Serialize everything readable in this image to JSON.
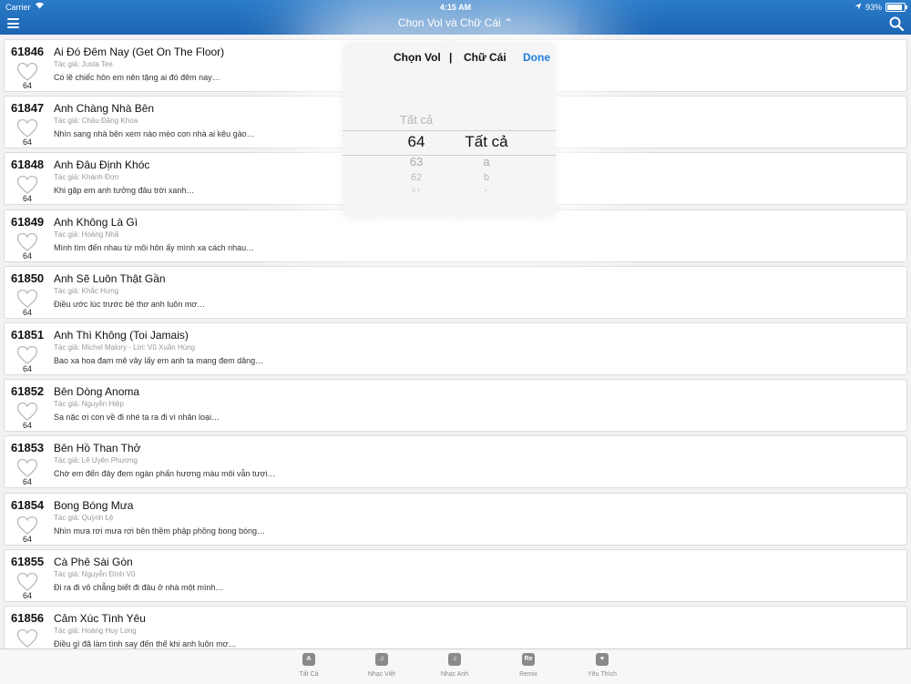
{
  "status": {
    "carrier": "Carrier",
    "time": "4:15 AM",
    "battery": "93%"
  },
  "nav": {
    "title": "Chọn Vol và Chữ Cái ⌃"
  },
  "songs": [
    {
      "id": "61846",
      "title": "Ai Đó Đêm Nay (Get On The Floor)",
      "author": "Tác giả: Justa Tee",
      "lyric": "Có lẽ chiếc hôn em nên tặng ai đó đêm nay…",
      "vol": "64"
    },
    {
      "id": "61847",
      "title": "Anh Chàng Nhà Bên",
      "author": "Tác giả: Châu Đăng Khoa",
      "lyric": "Nhìn sang nhà bên xem nào mèo con nhà ai kêu gào…",
      "vol": "64"
    },
    {
      "id": "61848",
      "title": "Anh Đâu Định Khóc",
      "author": "Tác giả: Khánh Đơn",
      "lyric": "Khi gặp em anh tưởng đâu trời xanh…",
      "vol": "64"
    },
    {
      "id": "61849",
      "title": "Anh Không Là Gì",
      "author": "Tác giả: Hoàng Nhã",
      "lyric": "Mình tìm đến nhau từ môi hôn ấy mình xa cách nhau…",
      "vol": "64"
    },
    {
      "id": "61850",
      "title": "Anh Sẽ Luôn Thật Gần",
      "author": "Tác giả: Khắc Hưng",
      "lyric": "Điều ước lúc trước bé thơ anh luôn mơ…",
      "vol": "64"
    },
    {
      "id": "61851",
      "title": "Anh Thì Không (Toi Jamais)",
      "author": "Tác giả: Michel Malory - Lời: Vũ Xuân Hùng",
      "lyric": "Bao xa hoa đam mê vây lấy em anh ta mang đem dâng…",
      "vol": "64"
    },
    {
      "id": "61852",
      "title": "Bên Dòng Anoma",
      "author": "Tác giả: Nguyễn Hiệp",
      "lyric": "Sa nặc ơi con về đi nhé ta ra đi vì nhân loại…",
      "vol": "64"
    },
    {
      "id": "61853",
      "title": "Bên Hồ Than Thở",
      "author": "Tác giả: Lê Uyên Phương",
      "lyric": "Chờ em đến đây đem ngàn phấn hương màu môi vẫn tươi…",
      "vol": "64"
    },
    {
      "id": "61854",
      "title": "Bong Bóng Mưa",
      "author": "Tác giả: Quỳnh Lệ",
      "lyric": "Nhìn mưa rơi mưa rơi bên thềm phập phồng bong bóng…",
      "vol": "64"
    },
    {
      "id": "61855",
      "title": "Cà Phê Sài Gòn",
      "author": "Tác giả: Nguyễn Đình Vũ",
      "lyric": "Đi ra đi vô chẳng biết đi đâu ở nhà một mình…",
      "vol": "64"
    },
    {
      "id": "61856",
      "title": "Cảm Xúc Tình Yêu",
      "author": "Tác giả: Hoàng Huy Long",
      "lyric": "Điều gì đã làm tình say đến thế khi anh luôn mơ…",
      "vol": "64"
    }
  ],
  "picker": {
    "header_vol": "Chọn Vol",
    "separator": "|",
    "header_letter": "Chữ Cái",
    "done": "Done",
    "vol_above": "Tất cả",
    "vol_selected": "64",
    "vol_below": [
      "63",
      "62",
      "61"
    ],
    "letter_selected": "Tất cả",
    "letter_below": [
      "a",
      "b",
      "c"
    ]
  },
  "tabs": [
    {
      "label": "Tất Cả",
      "icon": "A"
    },
    {
      "label": "Nhạc Việt",
      "icon": "♫"
    },
    {
      "label": "Nhạc Anh",
      "icon": "♫"
    },
    {
      "label": "Remix",
      "icon": "Re"
    },
    {
      "label": "Yêu Thích",
      "icon": "♥"
    }
  ],
  "colors": {
    "nav": "#1f6fbf",
    "done": "#1f7de0"
  }
}
